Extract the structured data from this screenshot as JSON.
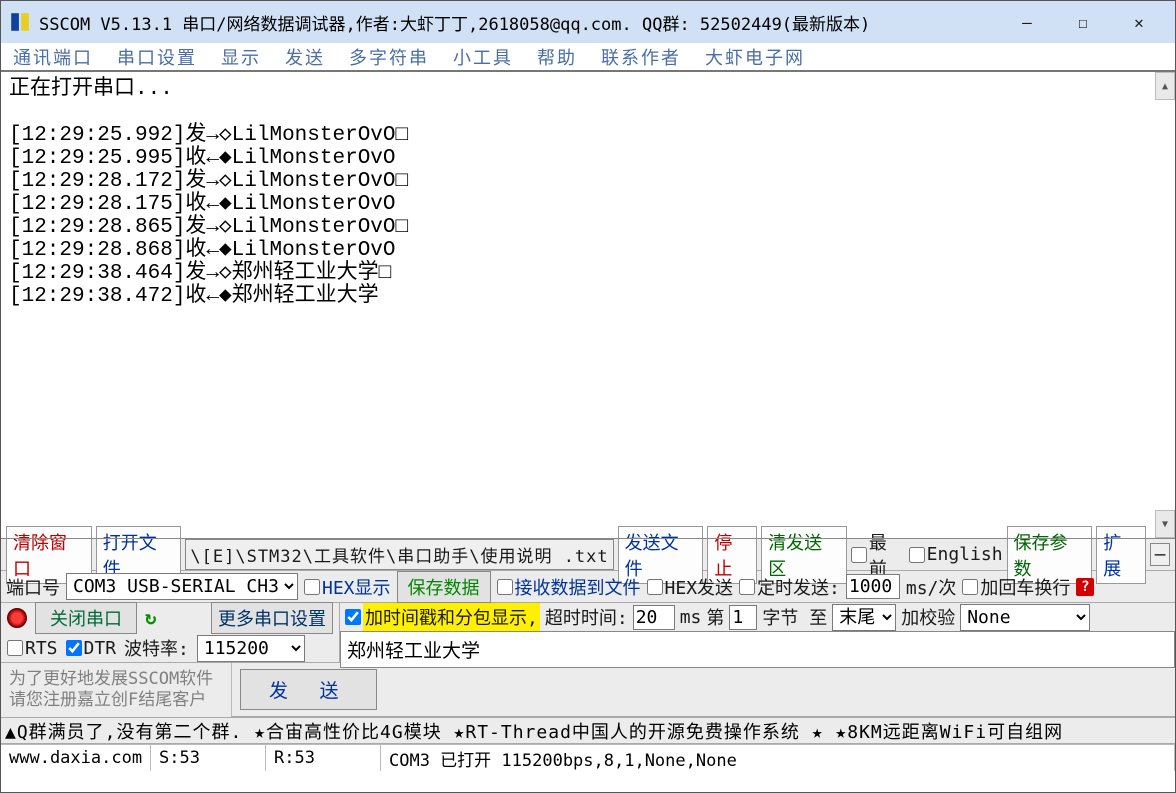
{
  "title": "SSCOM V5.13.1 串口/网络数据调试器,作者:大虾丁丁,2618058@qq.com. QQ群:  52502449(最新版本)",
  "menu": [
    "通讯端口",
    "串口设置",
    "显示",
    "发送",
    "多字符串",
    "小工具",
    "帮助",
    "联系作者",
    "大虾电子网"
  ],
  "log": "正在打开串口...\n\n[12:29:25.992]发→◇LilMonsterOvO□\n[12:29:25.995]收←◆LilMonsterOvO\n[12:29:28.172]发→◇LilMonsterOvO□\n[12:29:28.175]收←◆LilMonsterOvO\n[12:29:28.865]发→◇LilMonsterOvO□\n[12:29:28.868]收←◆LilMonsterOvO\n[12:29:38.464]发→◇郑州轻工业大学□\n[12:29:38.472]收←◆郑州轻工业大学",
  "tb1": {
    "clear": "清除窗口",
    "openfile": "打开文件",
    "path": "\\[E]\\STM32\\工具软件\\串口助手\\使用说明 .txt",
    "sendfile": "发送文件",
    "stop": "停止",
    "clearSend": "清发送区",
    "top": "最前",
    "english": "English",
    "saveParam": "保存参数",
    "expand": "扩展"
  },
  "tb2": {
    "portlbl": "端口号",
    "port": "COM3 USB-SERIAL CH340",
    "hexshow": "HEX显示",
    "savedata": "保存数据",
    "recvfile": "接收数据到文件",
    "hexsend": "HEX发送",
    "timedsend": "定时发送:",
    "interval": "1000",
    "msper": "ms/次",
    "crlf": "加回车换行"
  },
  "tb3": {
    "close": "关闭串口",
    "more": "更多串口设置",
    "tschk": "加时间戳和分包显示,",
    "timeoutlbl": "超时时间:",
    "timeout": "20",
    "ms": "ms",
    "bytelbl1": "第",
    "byteval": "1",
    "bytelbl2": "字节 至",
    "tail": "末尾",
    "chksum": "加校验",
    "chksumval": "None"
  },
  "tb4": {
    "rts": "RTS",
    "dtr": "DTR",
    "baudlbl": "波特率:",
    "baud": "115200",
    "hint1": "为了更好地发展SSCOM软件",
    "hint2": "请您注册嘉立创F结尾客户",
    "send": "发 送",
    "sendtext": "郑州轻工业大学"
  },
  "ads": "▲Q群满员了,没有第二个群. ★合宙高性价比4G模块  ★RT-Thread中国人的开源免费操作系统  ★ ★8KM远距离WiFi可自组网",
  "status": {
    "url": "www.daxia.com",
    "s": "S:53",
    "r": "R:53",
    "port": "COM3 已打开 115200bps,8,1,None,None"
  }
}
